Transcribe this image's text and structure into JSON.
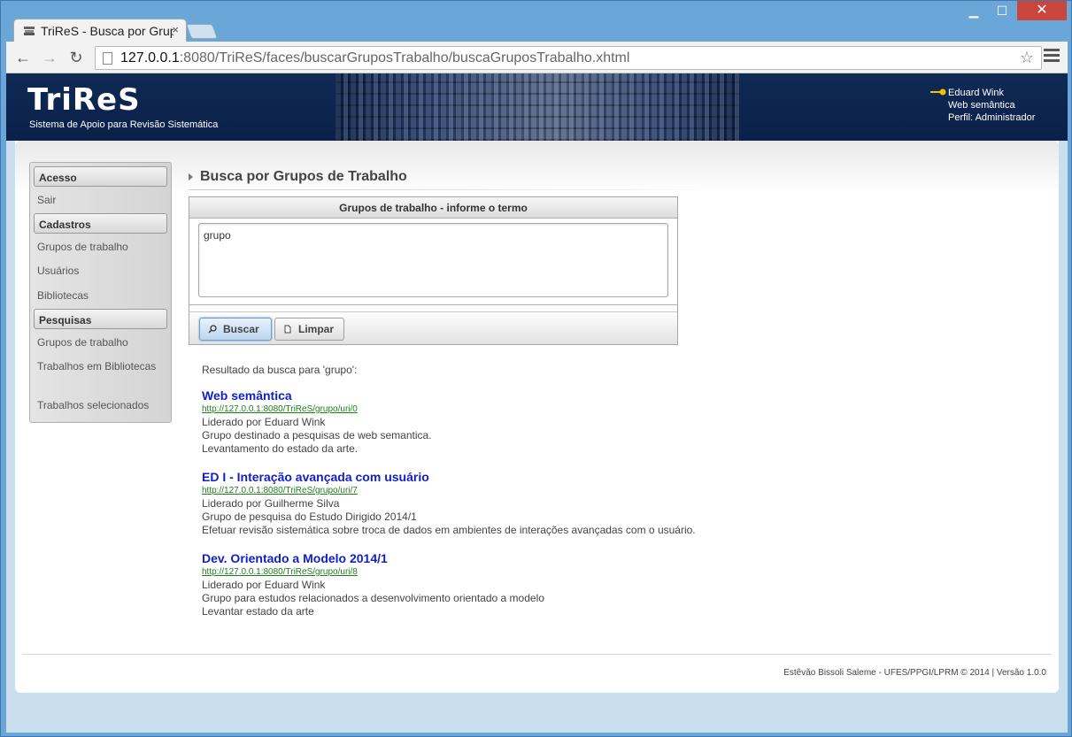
{
  "browser": {
    "tab_title": "TriReS - Busca por Grupos de Trabalho",
    "url_host": "127.0.0.1",
    "url_rest": ":8080/TriReS/faces/buscarGruposTrabalho/buscaGruposTrabalho.xhtml",
    "icons": [
      "back-icon",
      "forward-icon",
      "reload-icon",
      "star-icon",
      "menu-icon"
    ]
  },
  "header": {
    "logo": "TriReS",
    "tagline": "Sistema de Apoio para Revisão Sistemática",
    "user_name": "Eduard Wink",
    "user_group": "Web semântica",
    "user_profile": "Perfil: Administrador"
  },
  "sidebar": {
    "sections": [
      {
        "title": "Acesso",
        "items": [
          "Sair"
        ]
      },
      {
        "title": "Cadastros",
        "items": [
          "Grupos de trabalho",
          "Usuários",
          "Bibliotecas"
        ]
      },
      {
        "title": "Pesquisas",
        "items": [
          "Grupos de trabalho",
          "Trabalhos em Bibliotecas",
          "Trabalhos selecionados"
        ]
      }
    ]
  },
  "main": {
    "page_title": "Busca por Grupos de Trabalho",
    "panel_title": "Grupos de trabalho - informe o termo",
    "search_value": "grupo",
    "search_button": "Buscar",
    "clear_button": "Limpar",
    "result_intro": "Resultado da busca para 'grupo':",
    "results": [
      {
        "title": "Web semântica",
        "url": "http://127.0.0.1:8080/TriReS/grupo/uri/0",
        "lines": [
          "Liderado por Eduard Wink",
          "Grupo destinado a pesquisas de web semantica.",
          "Levantamento do estado da arte."
        ]
      },
      {
        "title": "ED I - Interação avançada com usuário",
        "url": "http://127.0.0.1:8080/TriReS/grupo/uri/7",
        "lines": [
          "Liderado por Guilherme Silva",
          "Grupo de pesquisa do Estudo Dirigido 2014/1",
          "Efetuar revisão sistemática sobre troca de dados em ambientes de interações avançadas com o usuário."
        ]
      },
      {
        "title": "Dev. Orientado a Modelo 2014/1",
        "url": "http://127.0.0.1:8080/TriReS/grupo/uri/8",
        "lines": [
          "Liderado por Eduard Wink",
          "Grupo para estudos relacionados a desenvolvimento orientado a modelo",
          "Levantar estado da arte"
        ]
      }
    ]
  },
  "footer": {
    "text": "Estêvão Bissoli Saleme - UFES/PPGI/LPRM © 2014 | Versão 1.0.0"
  },
  "colors": {
    "header_bg": "#0b2048",
    "link_title": "#1220c8",
    "link_url": "#1e7e1e"
  }
}
